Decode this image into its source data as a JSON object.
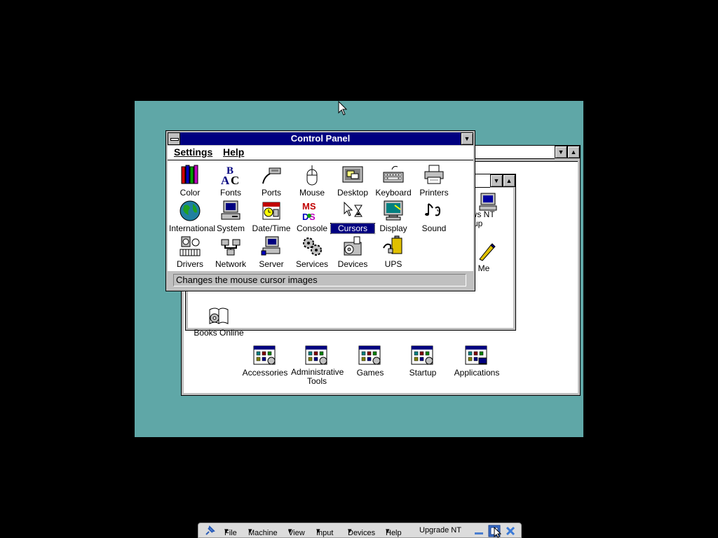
{
  "control_panel": {
    "title": "Control Panel",
    "menus": [
      "Settings",
      "Help"
    ],
    "items": [
      {
        "label": "Color",
        "icon": "color-pencils-icon"
      },
      {
        "label": "Fonts",
        "icon": "fonts-icon"
      },
      {
        "label": "Ports",
        "icon": "ports-plug-icon"
      },
      {
        "label": "Mouse",
        "icon": "mouse-icon"
      },
      {
        "label": "Desktop",
        "icon": "desktop-icon"
      },
      {
        "label": "Keyboard",
        "icon": "keyboard-icon"
      },
      {
        "label": "Printers",
        "icon": "printer-icon"
      },
      {
        "label": "International",
        "icon": "globe-icon"
      },
      {
        "label": "System",
        "icon": "system-computer-icon"
      },
      {
        "label": "Date/Time",
        "icon": "calendar-clock-icon"
      },
      {
        "label": "Console",
        "icon": "msdos-icon"
      },
      {
        "label": "Cursors",
        "icon": "cursors-icon",
        "selected": true
      },
      {
        "label": "Display",
        "icon": "display-monitor-icon"
      },
      {
        "label": "Sound",
        "icon": "sound-note-icon"
      },
      {
        "label": "Drivers",
        "icon": "drivers-icon"
      },
      {
        "label": "Network",
        "icon": "network-icon"
      },
      {
        "label": "Server",
        "icon": "server-icon"
      },
      {
        "label": "Services",
        "icon": "services-gears-icon"
      },
      {
        "label": "Devices",
        "icon": "devices-icon"
      },
      {
        "label": "UPS",
        "icon": "ups-battery-icon"
      }
    ],
    "status": "Changes the mouse cursor images"
  },
  "program_manager": {
    "groups": [
      {
        "label": "Accessories"
      },
      {
        "label": "Administrative Tools"
      },
      {
        "label": "Games"
      },
      {
        "label": "Startup"
      },
      {
        "label": "Applications"
      }
    ]
  },
  "main_group": {
    "visible_items": [
      {
        "label": "ows NT\netup"
      },
      {
        "label": "ad Me"
      },
      {
        "label": "Books Online"
      }
    ]
  },
  "vbox_menu": [
    "File",
    "Machine",
    "View",
    "Input",
    "Devices",
    "Help",
    "Upgrade NT"
  ],
  "colors": {
    "title_active": "#000080",
    "desktop": "#5fa7a7",
    "face": "#c0c0c0"
  }
}
